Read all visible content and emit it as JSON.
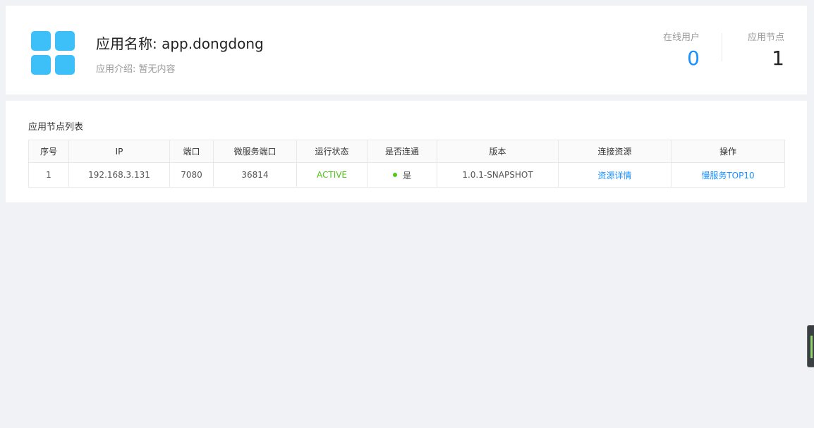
{
  "app": {
    "title": "应用名称: app.dongdong",
    "desc_label": "应用介绍:",
    "desc_value": "暂无内容",
    "icon_color": "#3dbff7"
  },
  "stats": {
    "online_label": "在线用户",
    "online_value": "0",
    "nodes_label": "应用节点",
    "nodes_value": "1"
  },
  "node_list": {
    "title": "应用节点列表",
    "headers": [
      "序号",
      "IP",
      "端口",
      "微服务端口",
      "运行状态",
      "是否连通",
      "版本",
      "连接资源",
      "操作"
    ],
    "rows": [
      {
        "index": "1",
        "ip": "192.168.3.131",
        "port": "7080",
        "micro_port": "36814",
        "status": "ACTIVE",
        "connected": "是",
        "version": "1.0.1-SNAPSHOT",
        "resource_link": "资源详情",
        "action_link": "慢服务TOP10"
      }
    ]
  },
  "colors": {
    "accent": "#1890ff",
    "success": "#52c41a",
    "background": "#f0f2f5"
  }
}
